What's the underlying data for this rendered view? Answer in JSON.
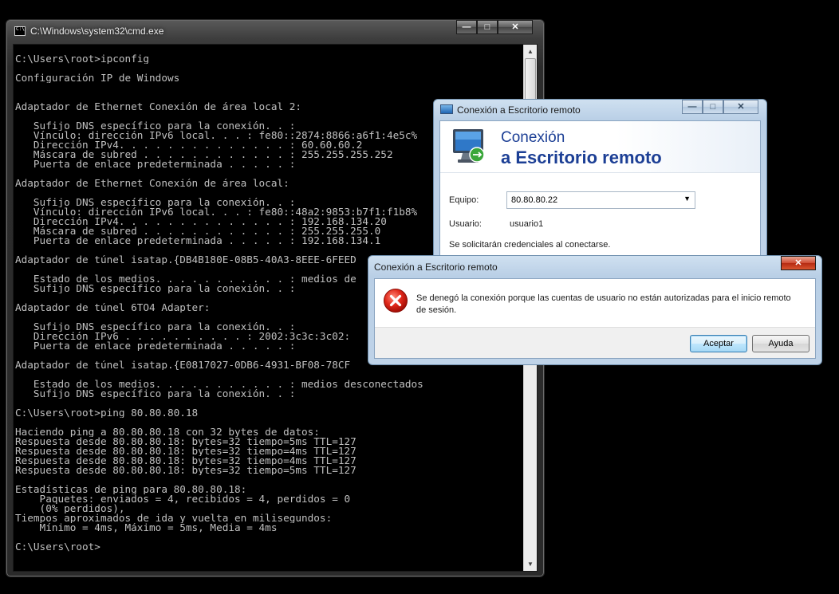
{
  "cmd_window": {
    "title": "C:\\Windows\\system32\\cmd.exe",
    "console_lines": [
      "C:\\Users\\root>ipconfig",
      "",
      "Configuración IP de Windows",
      "",
      "",
      "Adaptador de Ethernet Conexión de área local 2:",
      "",
      "   Sufijo DNS específico para la conexión. . :",
      "   Vínculo: dirección IPv6 local. . . : fe80::2874:8866:a6f1:4e5c%",
      "   Dirección IPv4. . . . . . . . . . . . . . : 60.60.60.2",
      "   Máscara de subred . . . . . . . . . . . . : 255.255.255.252",
      "   Puerta de enlace predeterminada . . . . . :",
      "",
      "Adaptador de Ethernet Conexión de área local:",
      "",
      "   Sufijo DNS específico para la conexión. . :",
      "   Vínculo: dirección IPv6 local. . . : fe80::48a2:9853:b7f1:f1b8%",
      "   Dirección IPv4. . . . . . . . . . . . . . : 192.168.134.20",
      "   Máscara de subred . . . . . . . . . . . . : 255.255.255.0",
      "   Puerta de enlace predeterminada . . . . . : 192.168.134.1",
      "",
      "Adaptador de túnel isatap.{DB4B180E-08B5-40A3-8EEE-6FEED",
      "",
      "   Estado de los medios. . . . . . . . . . . : medios de",
      "   Sufijo DNS específico para la conexión. . :",
      "",
      "Adaptador de túnel 6TO4 Adapter:",
      "",
      "   Sufijo DNS específico para la conexión. . :",
      "   Dirección IPv6 . . . . . . . . . . : 2002:3c3c:3c02:",
      "   Puerta de enlace predeterminada . . . . . :",
      "",
      "Adaptador de túnel isatap.{E0817027-0DB6-4931-BF08-78CF",
      "",
      "   Estado de los medios. . . . . . . . . . . : medios desconectados",
      "   Sufijo DNS específico para la conexión. . :",
      "",
      "C:\\Users\\root>ping 80.80.80.18",
      "",
      "Haciendo ping a 80.80.80.18 con 32 bytes de datos:",
      "Respuesta desde 80.80.80.18: bytes=32 tiempo=5ms TTL=127",
      "Respuesta desde 80.80.80.18: bytes=32 tiempo=4ms TTL=127",
      "Respuesta desde 80.80.80.18: bytes=32 tiempo=4ms TTL=127",
      "Respuesta desde 80.80.80.18: bytes=32 tiempo=5ms TTL=127",
      "",
      "Estadísticas de ping para 80.80.80.18:",
      "    Paquetes: enviados = 4, recibidos = 4, perdidos = 0",
      "    (0% perdidos),",
      "Tiempos aproximados de ida y vuelta en milisegundos:",
      "    Mínimo = 4ms, Máximo = 5ms, Media = 4ms",
      "",
      "C:\\Users\\root>"
    ]
  },
  "rdp_window": {
    "title": "Conexión a Escritorio remoto",
    "heading_line1": "Conexión",
    "heading_line2": "a Escritorio remoto",
    "computer_label": "Equipo:",
    "computer_value": "80.80.80.22",
    "user_label": "Usuario:",
    "user_value": "usuario1",
    "credentials_note": "Se solicitarán credenciales al conectarse."
  },
  "error_dialog": {
    "title": "Conexión a Escritorio remoto",
    "message": "Se denegó la conexión porque las cuentas de usuario no están autorizadas para el inicio remoto de sesión.",
    "ok_label": "Aceptar",
    "help_label": "Ayuda"
  },
  "colors": {
    "console_text": "#c0c0c0",
    "rdp_heading": "#1c3f95",
    "close_red": "#c8401f"
  }
}
